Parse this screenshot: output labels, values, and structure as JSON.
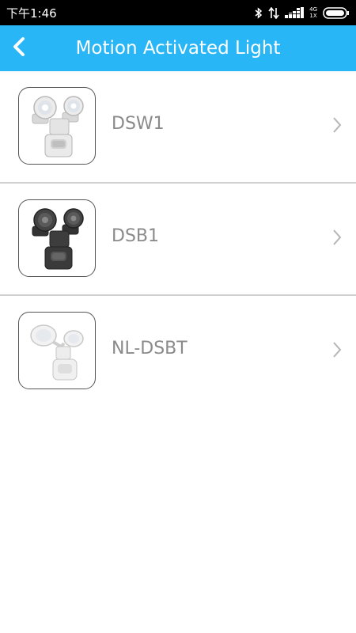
{
  "status_bar": {
    "time": "下午1:46",
    "network_type_top": "4G",
    "network_type_bottom": "1X",
    "icons": [
      "bluetooth-icon",
      "data-arrows-icon",
      "signal-icon",
      "battery-icon"
    ]
  },
  "header": {
    "title": "Motion Activated Light",
    "back_icon": "chevron-left-icon",
    "background_color": "#29b6f6"
  },
  "devices": [
    {
      "label": "DSW1",
      "image": "white-motion-light",
      "color": "#eeeeee"
    },
    {
      "label": "DSB1",
      "image": "dark-motion-light",
      "color": "#3a3a3a"
    },
    {
      "label": "NL-DSBT",
      "image": "white-motion-light-angled",
      "color": "#f2f2f2"
    }
  ]
}
